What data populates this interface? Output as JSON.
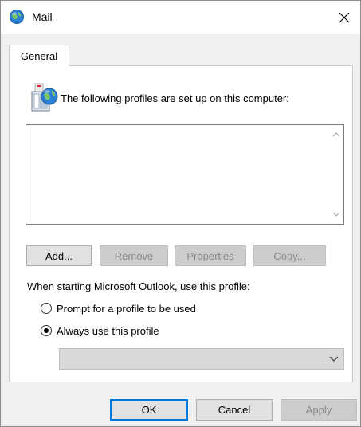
{
  "window": {
    "title": "Mail",
    "close_label": "Close",
    "app_icon": "mail-globe-icon"
  },
  "tabs": [
    {
      "label": "General",
      "selected": true
    }
  ],
  "profiles_section": {
    "icon": "profiles-computer-icon",
    "heading": "The following profiles are set up on this computer:",
    "profiles": []
  },
  "buttons": {
    "add": {
      "label": "Add...",
      "enabled": true
    },
    "remove": {
      "label": "Remove",
      "enabled": false
    },
    "properties": {
      "label": "Properties",
      "enabled": false
    },
    "copy": {
      "label": "Copy...",
      "enabled": false
    }
  },
  "startup": {
    "prompt_text": "When starting Microsoft Outlook, use this profile:",
    "options": [
      {
        "label": "Prompt for a profile to be used",
        "selected": false
      },
      {
        "label": "Always use this profile",
        "selected": true
      }
    ],
    "profile_combo_value": ""
  },
  "footer": {
    "ok": {
      "label": "OK",
      "enabled": true,
      "default": true
    },
    "cancel": {
      "label": "Cancel",
      "enabled": true
    },
    "apply": {
      "label": "Apply",
      "enabled": false
    }
  },
  "colors": {
    "accent": "#0078d7",
    "disabled_text": "#8a8a8a"
  }
}
